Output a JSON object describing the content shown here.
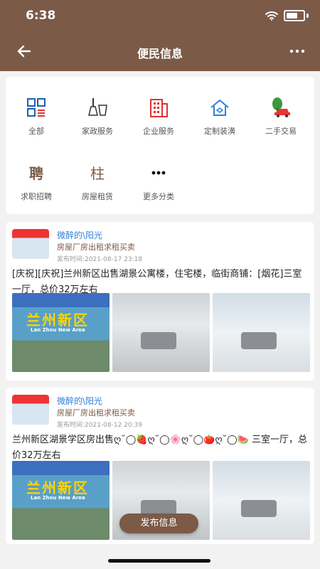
{
  "status": {
    "time": "6:38"
  },
  "header": {
    "title": "便民信息"
  },
  "categories": [
    {
      "label": "全部",
      "icon": "grid-icon"
    },
    {
      "label": "家政服务",
      "icon": "broom-bucket-icon"
    },
    {
      "label": "企业服务",
      "icon": "building-icon"
    },
    {
      "label": "定制装潢",
      "icon": "house-icon"
    },
    {
      "label": "二手交易",
      "icon": "car-tree-icon"
    },
    {
      "label": "求职招聘",
      "icon": "recruit-icon"
    },
    {
      "label": "房屋租赁",
      "icon": "rent-house-icon"
    },
    {
      "label": "更多分类",
      "icon": "more-dots-icon"
    }
  ],
  "posts": [
    {
      "author": "微醉的\\阳光",
      "category": "房屋厂房出租求租买卖",
      "time": "发布时间:2021-08-17 23:18",
      "content": "[庆祝][庆祝]兰州新区出售湖景公寓楼，住宅楼，临街商铺：[烟花]三室一厅，总价32万左右",
      "image_text_title": "兰州新区",
      "image_text_sub": "Lan Zhou New Area"
    },
    {
      "author": "微醉的\\阳光",
      "category": "房屋厂房出租求租买卖",
      "time": "发布时间:2021-08-12 20:39",
      "content": "兰州新区湖景学区房出售ღ˘◯🍓ღ˘◯🌸ღ˘◯🍅ღ˘◯🍉 三室一厅，总价32万左右",
      "image_text_title": "兰州新区",
      "image_text_sub": "Lan Zhou New Area"
    }
  ],
  "publish_button": "发布信息"
}
